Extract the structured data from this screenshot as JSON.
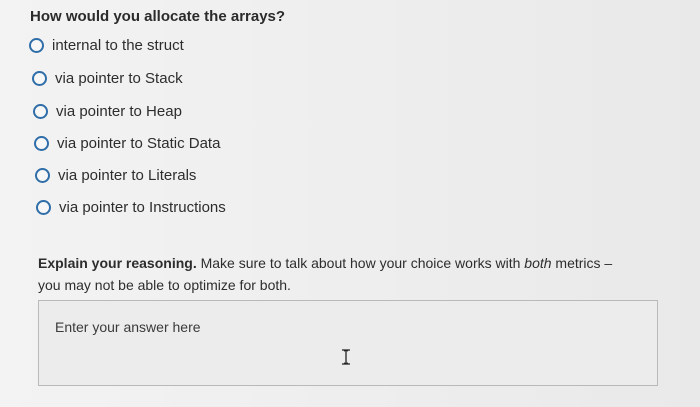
{
  "question": {
    "title": "How would you allocate the arrays?",
    "options": [
      "internal to the struct",
      "via pointer to Stack",
      "via pointer to Heap",
      "via pointer to Static Data",
      "via pointer to Literals",
      "via pointer to Instructions"
    ]
  },
  "explanation": {
    "bold_lead": "Explain your reasoning.",
    "text_before_italic": " Make sure to talk about how your choice works with ",
    "italic": "both",
    "text_after_italic": " metrics –",
    "second_line": "you may not be able to optimize for both."
  },
  "answer": {
    "placeholder": "Enter your answer here"
  },
  "colors": {
    "radio_border": "#2f6ea8",
    "text": "#2d2d2d",
    "background": "#eeeeee"
  },
  "icons": {
    "text_cursor": "i-beam-cursor-icon"
  }
}
